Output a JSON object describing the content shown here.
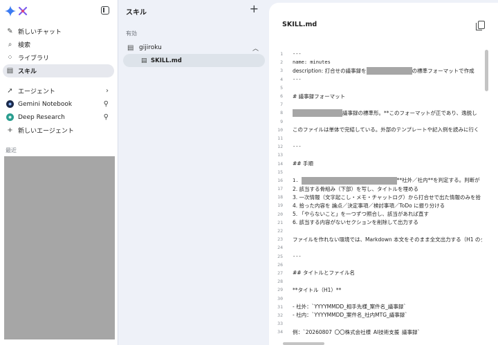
{
  "sidebar": {
    "items": [
      {
        "label": "新しいチャット",
        "icon": "new-chat-icon"
      },
      {
        "label": "検索",
        "icon": "search-icon"
      },
      {
        "label": "ライブラリ",
        "icon": "library-icon"
      },
      {
        "label": "スキル",
        "icon": "skill-icon",
        "active": true
      }
    ],
    "agents": [
      {
        "label": "エージェント",
        "icon": "agent-icon"
      },
      {
        "label": "Gemini Notebook",
        "icon": "notebook-avatar"
      },
      {
        "label": "Deep Research",
        "icon": "research-avatar"
      },
      {
        "label": "新しいエージェント",
        "icon": "plus-icon"
      }
    ],
    "recent_label": "最近"
  },
  "skills_panel": {
    "title": "スキル",
    "section_label": "有効",
    "folder": "gijiroku",
    "file": "SKILL.md"
  },
  "editor": {
    "title": "SKILL.md",
    "lines": [
      {
        "n": "1",
        "segments": [
          {
            "t": "---"
          }
        ]
      },
      {
        "n": "2",
        "segments": [
          {
            "t": "name: minutes"
          }
        ]
      },
      {
        "n": "3",
        "segments": [
          {
            "t": "description: 打合せの議事録を"
          },
          {
            "r": 66
          },
          {
            "t": "の標準フォーマットで作成"
          }
        ]
      },
      {
        "n": "4",
        "segments": [
          {
            "t": "---"
          }
        ]
      },
      {
        "n": "5",
        "segments": []
      },
      {
        "n": "6",
        "segments": [
          {
            "t": "# 議事録フォーマット"
          }
        ]
      },
      {
        "n": "7",
        "segments": []
      },
      {
        "n": "8",
        "segments": [
          {
            "r": 72
          },
          {
            "t": "議事録の標準形。**このフォーマットが正であり、逸脱し"
          }
        ]
      },
      {
        "n": "9",
        "segments": []
      },
      {
        "n": "10",
        "segments": [
          {
            "t": "このファイルは単体で完結している。外部のテンプレートや記入例を読みに行く"
          }
        ]
      },
      {
        "n": "11",
        "segments": []
      },
      {
        "n": "12",
        "segments": [
          {
            "t": "---"
          }
        ]
      },
      {
        "n": "13",
        "segments": []
      },
      {
        "n": "14",
        "segments": [
          {
            "t": "## 手順"
          }
        ]
      },
      {
        "n": "15",
        "segments": []
      },
      {
        "n": "16",
        "segments": [
          {
            "t": "1. "
          },
          {
            "r": 138
          },
          {
            "t": "**社外／社内**を判定する。判断が"
          }
        ]
      },
      {
        "n": "17",
        "segments": [
          {
            "t": "2. 該当する骨組み（下部）を写し、タイトルを埋める"
          }
        ]
      },
      {
        "n": "18",
        "segments": [
          {
            "t": "3. 一次情報（文字起こし・メモ・チャットログ）から打合せで出た情報のみを拾"
          }
        ]
      },
      {
        "n": "19",
        "segments": [
          {
            "t": "4. 拾った内容を 論点／決定事項／検討事項／ToDo に振り分ける"
          }
        ]
      },
      {
        "n": "20",
        "segments": [
          {
            "t": "5. 「やらないこと」を一つずつ照合し、該当があれば直す"
          }
        ]
      },
      {
        "n": "21",
        "segments": [
          {
            "t": "6. 該当する内容がないセクションを削除して出力する"
          }
        ]
      },
      {
        "n": "22",
        "segments": []
      },
      {
        "n": "23",
        "segments": [
          {
            "t": "ファイルを作れない環境では、Markdown 本文をそのまま全文出力する（H1 のタ"
          }
        ]
      },
      {
        "n": "24",
        "segments": []
      },
      {
        "n": "25",
        "segments": [
          {
            "t": "---"
          }
        ]
      },
      {
        "n": "26",
        "segments": []
      },
      {
        "n": "27",
        "segments": [
          {
            "t": "## タイトルとファイル名"
          }
        ]
      },
      {
        "n": "28",
        "segments": []
      },
      {
        "n": "29",
        "segments": [
          {
            "t": "**タイトル（H1）**"
          }
        ]
      },
      {
        "n": "30",
        "segments": []
      },
      {
        "n": "31",
        "segments": [
          {
            "t": "- 社外：`YYYYMMDD_相手先様_案件名_議事録`"
          }
        ]
      },
      {
        "n": "32",
        "segments": [
          {
            "t": "- 社内：`YYYYMMDD_案件名_社内MTG_議事録`"
          }
        ]
      },
      {
        "n": "33",
        "segments": []
      },
      {
        "n": "34",
        "segments": [
          {
            "t": "例：`20260807_〇〇株式会社様_AI技術支援_議事録`"
          }
        ]
      }
    ]
  }
}
